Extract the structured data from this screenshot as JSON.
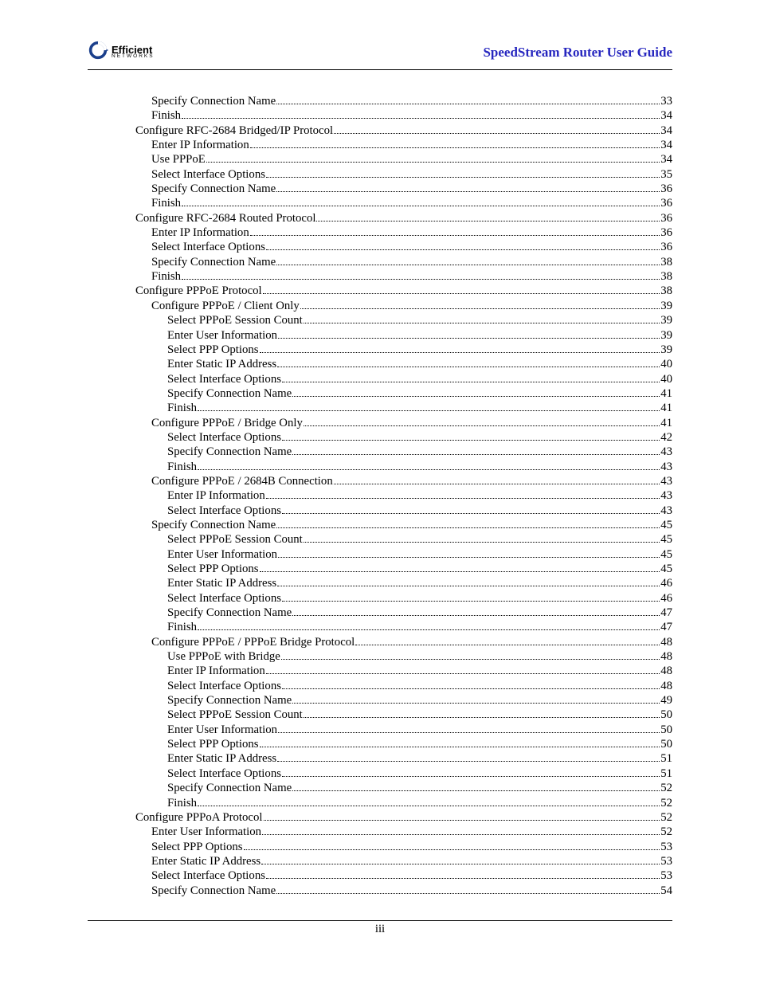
{
  "header": {
    "brand_main": "Efficient",
    "brand_sub": "NETWORKS",
    "doc_title": "SpeedStream Router User Guide"
  },
  "footer": {
    "page_number": "iii"
  },
  "toc": [
    {
      "level": 4,
      "label": "Specify Connection Name",
      "page": "33"
    },
    {
      "level": 4,
      "label": "Finish",
      "page": "34"
    },
    {
      "level": 3,
      "label": "Configure RFC-2684 Bridged/IP Protocol",
      "page": "34"
    },
    {
      "level": 4,
      "label": "Enter IP Information",
      "page": "34"
    },
    {
      "level": 4,
      "label": "Use PPPoE",
      "page": "34"
    },
    {
      "level": 4,
      "label": "Select Interface Options",
      "page": "35"
    },
    {
      "level": 4,
      "label": "Specify Connection Name",
      "page": "36"
    },
    {
      "level": 4,
      "label": "Finish",
      "page": "36"
    },
    {
      "level": 3,
      "label": "Configure RFC-2684 Routed Protocol",
      "page": "36"
    },
    {
      "level": 4,
      "label": "Enter IP Information",
      "page": "36"
    },
    {
      "level": 4,
      "label": "Select Interface Options",
      "page": "36"
    },
    {
      "level": 4,
      "label": "Specify Connection Name",
      "page": "38"
    },
    {
      "level": 4,
      "label": "Finish",
      "page": "38"
    },
    {
      "level": 3,
      "label": "Configure PPPoE Protocol",
      "page": "38"
    },
    {
      "level": 4,
      "label": "Configure PPPoE / Client Only",
      "page": "39"
    },
    {
      "level": 5,
      "label": "Select PPPoE Session Count",
      "page": "39"
    },
    {
      "level": 5,
      "label": "Enter User Information",
      "page": "39"
    },
    {
      "level": 5,
      "label": "Select PPP Options",
      "page": "39"
    },
    {
      "level": 5,
      "label": "Enter Static IP Address",
      "page": "40"
    },
    {
      "level": 5,
      "label": "Select Interface Options",
      "page": "40"
    },
    {
      "level": 5,
      "label": "Specify Connection Name",
      "page": "41"
    },
    {
      "level": 5,
      "label": "Finish",
      "page": "41"
    },
    {
      "level": 4,
      "label": "Configure PPPoE / Bridge Only",
      "page": "41"
    },
    {
      "level": 5,
      "label": "Select Interface Options",
      "page": "42"
    },
    {
      "level": 5,
      "label": "Specify Connection Name",
      "page": "43"
    },
    {
      "level": 5,
      "label": "Finish",
      "page": "43"
    },
    {
      "level": 4,
      "label": "Configure PPPoE / 2684B Connection",
      "page": "43"
    },
    {
      "level": 5,
      "label": "Enter IP Information",
      "page": "43"
    },
    {
      "level": 5,
      "label": "Select Interface Options",
      "page": "43"
    },
    {
      "level": 4,
      "label": "Specify Connection Name",
      "page": "45"
    },
    {
      "level": 5,
      "label": "Select PPPoE Session Count",
      "page": "45"
    },
    {
      "level": 5,
      "label": "Enter User Information",
      "page": "45"
    },
    {
      "level": 5,
      "label": "Select PPP Options",
      "page": "45"
    },
    {
      "level": 5,
      "label": "Enter Static IP Address",
      "page": "46"
    },
    {
      "level": 5,
      "label": "Select Interface Options",
      "page": "46"
    },
    {
      "level": 5,
      "label": "Specify Connection Name",
      "page": "47"
    },
    {
      "level": 5,
      "label": "Finish",
      "page": "47"
    },
    {
      "level": 4,
      "label": "Configure PPPoE / PPPoE Bridge Protocol",
      "page": "48"
    },
    {
      "level": 5,
      "label": "Use PPPoE with Bridge",
      "page": "48"
    },
    {
      "level": 5,
      "label": "Enter IP Information",
      "page": "48"
    },
    {
      "level": 5,
      "label": "Select Interface Options",
      "page": "48"
    },
    {
      "level": 5,
      "label": "Specify Connection Name",
      "page": "49"
    },
    {
      "level": 5,
      "label": "Select PPPoE Session Count",
      "page": "50"
    },
    {
      "level": 5,
      "label": "Enter User Information",
      "page": "50"
    },
    {
      "level": 5,
      "label": "Select PPP Options",
      "page": "50"
    },
    {
      "level": 5,
      "label": "Enter Static IP Address",
      "page": "51"
    },
    {
      "level": 5,
      "label": "Select Interface Options",
      "page": "51"
    },
    {
      "level": 5,
      "label": "Specify Connection Name",
      "page": "52"
    },
    {
      "level": 5,
      "label": "Finish",
      "page": "52"
    },
    {
      "level": 3,
      "label": "Configure PPPoA Protocol",
      "page": "52"
    },
    {
      "level": 4,
      "label": "Enter User Information",
      "page": "52"
    },
    {
      "level": 4,
      "label": "Select PPP Options",
      "page": "53"
    },
    {
      "level": 4,
      "label": "Enter Static IP Address",
      "page": "53"
    },
    {
      "level": 4,
      "label": "Select Interface Options",
      "page": "53"
    },
    {
      "level": 4,
      "label": "Specify Connection Name",
      "page": "54"
    }
  ]
}
